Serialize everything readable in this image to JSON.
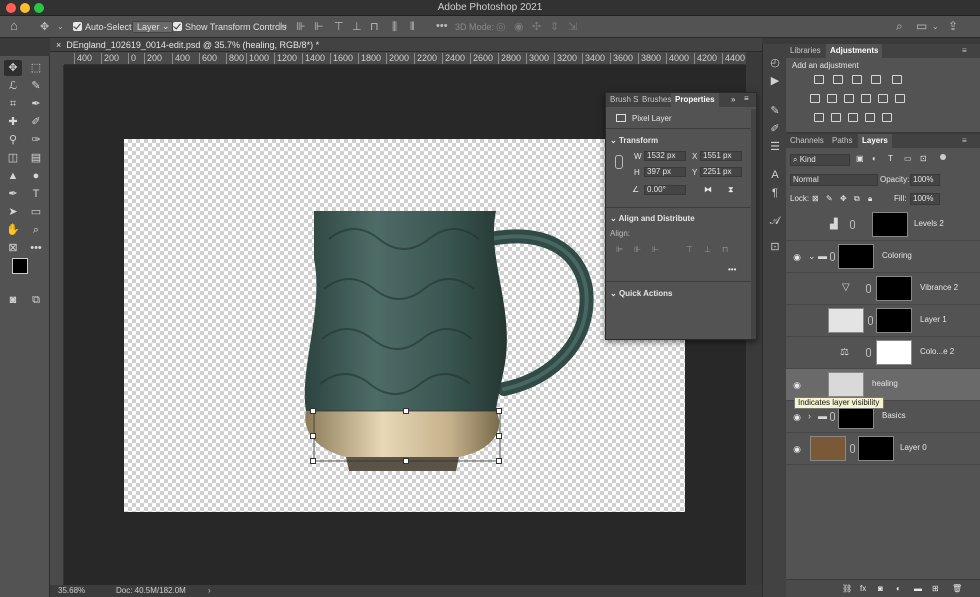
{
  "window": {
    "title": "Adobe Photoshop 2021"
  },
  "options_bar": {
    "auto_select_label": "Auto-Select:",
    "auto_select_value": "Layer",
    "show_transform_label": "Show Transform Controls",
    "mode_3d_label": "3D Mode:"
  },
  "document": {
    "tab_title": "DEngland_102619_0014-edit.psd @ 35.7% (healing, RGB/8*) *",
    "zoom": "35.68%",
    "doc_size": "Doc: 40.5M/182.0M"
  },
  "ruler": {
    "ticks": [
      "400",
      "200",
      "0",
      "200",
      "400",
      "600",
      "800",
      "1000",
      "1200",
      "1400",
      "1600",
      "1800",
      "2000",
      "2200",
      "2400",
      "2600",
      "2800",
      "3000",
      "3200",
      "3400",
      "3600",
      "3800",
      "4000",
      "4200",
      "4400"
    ]
  },
  "properties_panel": {
    "tabs": [
      "Brush S",
      "Brushes",
      "Properties"
    ],
    "active_tab": "Properties",
    "layer_kind": "Pixel Layer",
    "transform_heading": "Transform",
    "w_label": "W",
    "w_value": "1532 px",
    "h_label": "H",
    "h_value": "397 px",
    "x_label": "X",
    "x_value": "1551 px",
    "y_label": "Y",
    "y_value": "2251 px",
    "angle_value": "0.00°",
    "align_heading": "Align and Distribute",
    "align_label": "Align:",
    "quick_actions_heading": "Quick Actions"
  },
  "adjust_panel": {
    "tabs": [
      "Libraries",
      "Adjustments"
    ],
    "active_tab": "Adjustments",
    "add_label": "Add an adjustment"
  },
  "layers_panel": {
    "tabs": [
      "Channels",
      "Paths",
      "Layers"
    ],
    "active_tab": "Layers",
    "filter_kind": "Kind",
    "blend_mode": "Normal",
    "opacity_label": "Opacity:",
    "opacity_value": "100%",
    "lock_label": "Lock:",
    "fill_label": "Fill:",
    "fill_value": "100%",
    "layers": [
      {
        "name": "Levels 2",
        "visible": false
      },
      {
        "name": "Coloring",
        "visible": true
      },
      {
        "name": "Vibrance 2",
        "visible": false
      },
      {
        "name": "Layer 1",
        "visible": false
      },
      {
        "name": "Colo...e 2",
        "visible": false
      },
      {
        "name": "healing",
        "visible": true,
        "selected": true
      },
      {
        "name": "Basics",
        "visible": true
      },
      {
        "name": "Layer 0",
        "visible": true
      }
    ],
    "tooltip": "Indicates layer visibility"
  },
  "colors": {
    "accent": "#2f6feb",
    "panel_bg": "#535353",
    "mug_body": "#3d5a55"
  }
}
